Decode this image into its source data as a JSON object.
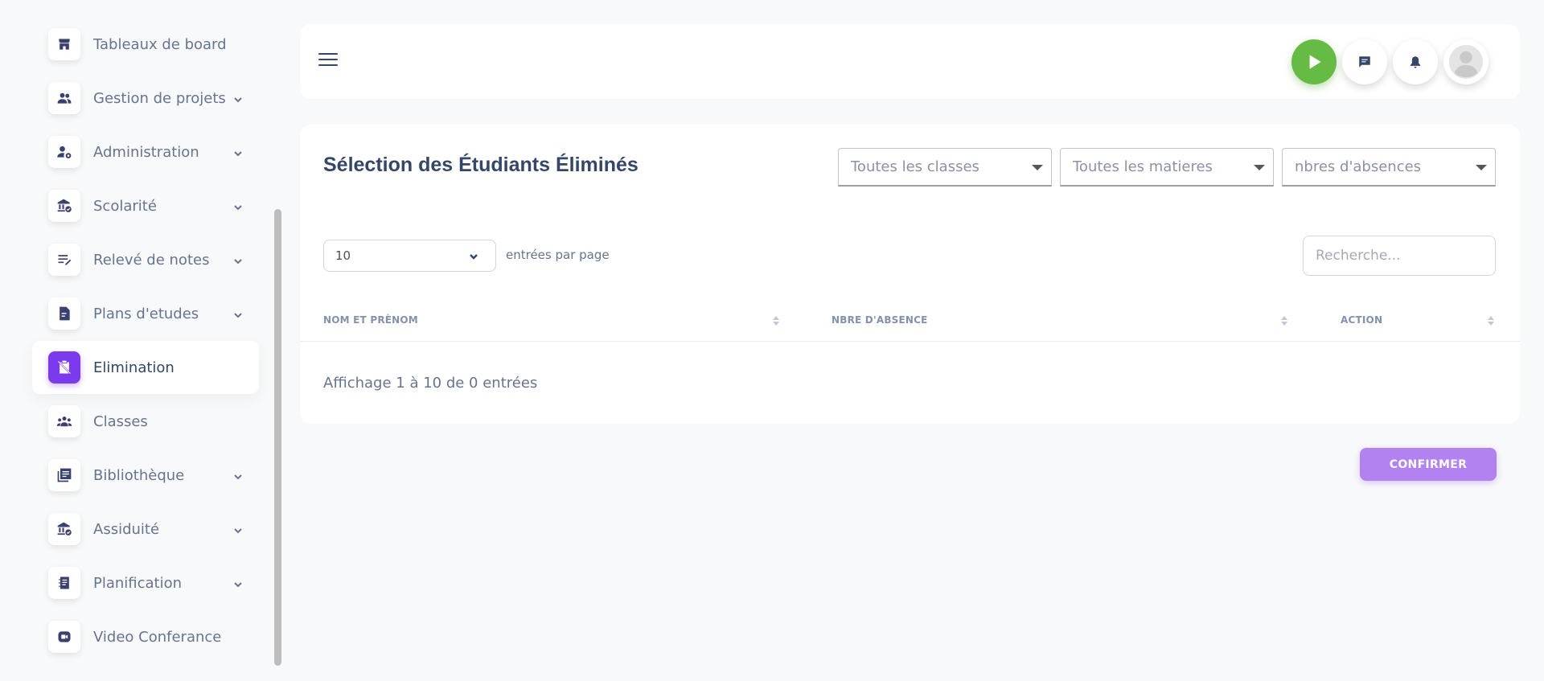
{
  "sidebar": {
    "items": [
      {
        "label": "Tableaux de board",
        "icon": "shop-icon",
        "has_chevron": false
      },
      {
        "label": "Gestion de projets",
        "icon": "people-icon",
        "has_chevron": true
      },
      {
        "label": "Administration",
        "icon": "user-gear-icon",
        "has_chevron": true
      },
      {
        "label": "Scolarité",
        "icon": "institution-check-icon",
        "has_chevron": true
      },
      {
        "label": "Relevé de notes",
        "icon": "edit-notes-icon",
        "has_chevron": true
      },
      {
        "label": "Plans d'etudes",
        "icon": "document-icon",
        "has_chevron": true
      },
      {
        "label": "Elimination",
        "icon": "clipboard-off-icon",
        "has_chevron": false,
        "active": true
      },
      {
        "label": "Classes",
        "icon": "group-icon",
        "has_chevron": false
      },
      {
        "label": "Bibliothèque",
        "icon": "library-icon",
        "has_chevron": true
      },
      {
        "label": "Assiduité",
        "icon": "institution-check-icon",
        "has_chevron": true
      },
      {
        "label": "Planification",
        "icon": "notebook-icon",
        "has_chevron": true
      },
      {
        "label": "Video Conferance",
        "icon": "video-icon",
        "has_chevron": false
      }
    ]
  },
  "navbar": {
    "icons": [
      "menu-icon",
      "play-icon",
      "chat-icon",
      "bell-icon",
      "avatar-icon"
    ],
    "play_color": "#66bb44"
  },
  "main": {
    "title": "Sélection des Étudiants Éliminés",
    "filters": {
      "classes": "Toutes les classes",
      "matieres": "Toutes les matieres",
      "absences": "nbres d'absences"
    },
    "per_page_value": "10",
    "per_page_label": "entrées par page",
    "search_placeholder": "Recherche...",
    "columns": [
      "NOM ET PRÈNOM",
      "NBRE D'ABSENCE",
      "ACTION"
    ],
    "info": "Affichage 1 à 10 de 0 entrées",
    "confirm_label": "CONFIRMER",
    "accent_color": "#7c3aed"
  }
}
